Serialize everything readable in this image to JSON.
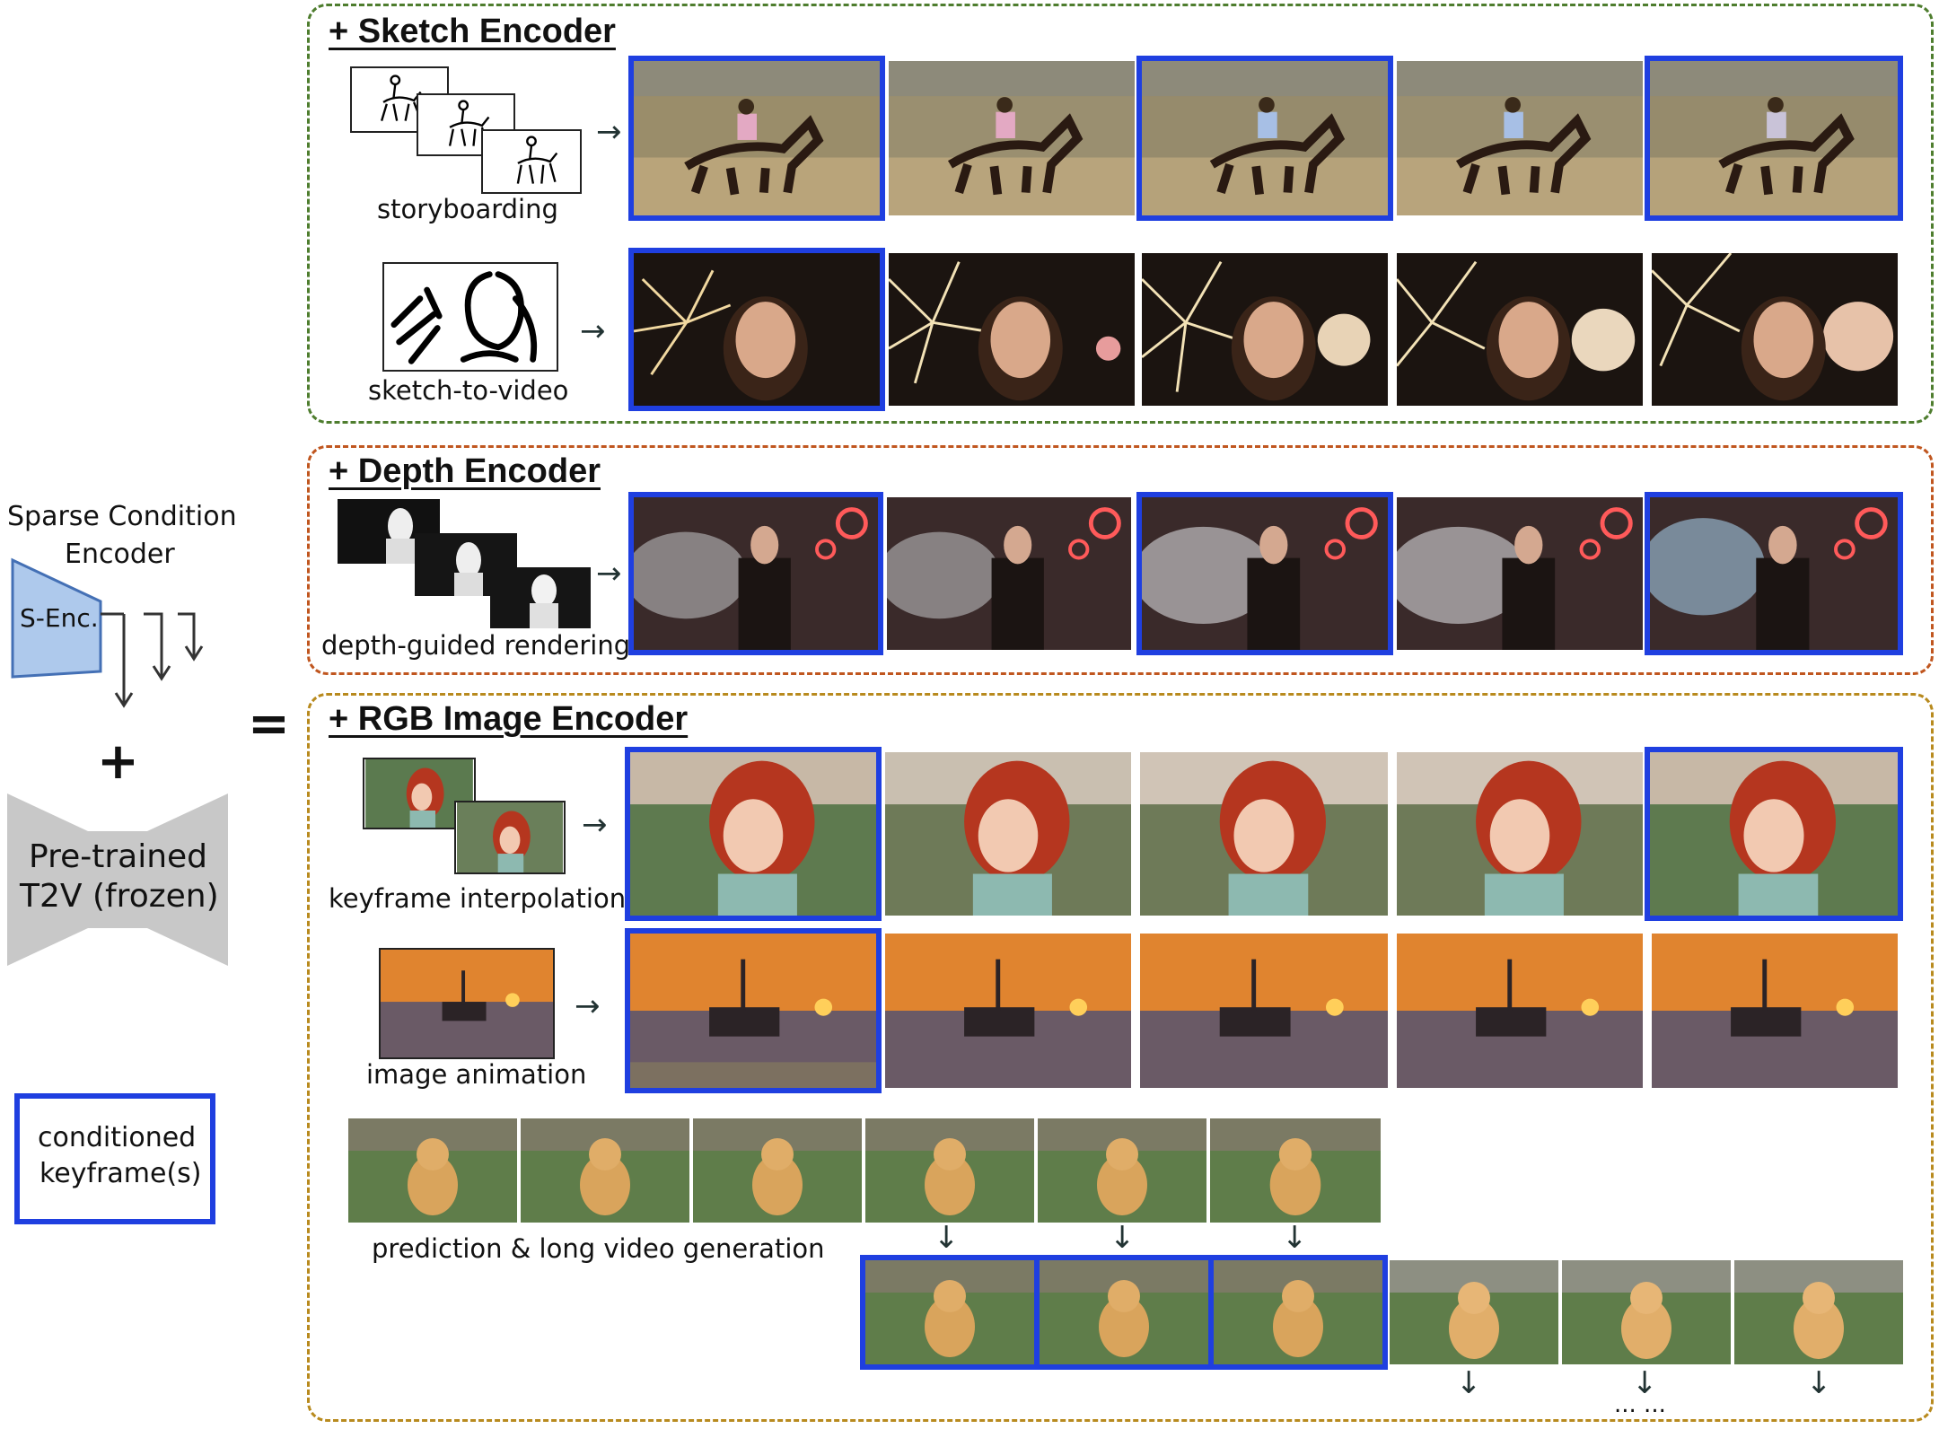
{
  "left": {
    "encoder_title_line1": "Sparse Condition",
    "encoder_title_line2": "Encoder",
    "senc_label": "S-Enc.",
    "plus": "+",
    "equals": "=",
    "t2v_line1": "Pre-trained",
    "t2v_line2": "T2V (frozen)",
    "legend_line1": "conditioned",
    "legend_line2": "keyframe(s)"
  },
  "sketch": {
    "title": "+ Sketch Encoder",
    "storyboarding": "storyboarding",
    "sketch_to_video": "sketch-to-video"
  },
  "depth": {
    "title": "+ Depth Encoder",
    "depth_guided": "depth-guided rendering"
  },
  "rgb": {
    "title": "+ RGB Image Encoder",
    "keyframe": "keyframe interpolation",
    "animation": "image animation",
    "prediction": "prediction & long video generation",
    "ellipsis": "... ..."
  },
  "colors": {
    "sketch_border": "#4e7d2e",
    "depth_border": "#c0561f",
    "rgb_border": "#b88a1e",
    "keyframe_blue": "#1f3fe0",
    "senc_fill": "#aec9ec",
    "senc_stroke": "#4470b5",
    "t2v_fill": "#c8c8c8"
  }
}
